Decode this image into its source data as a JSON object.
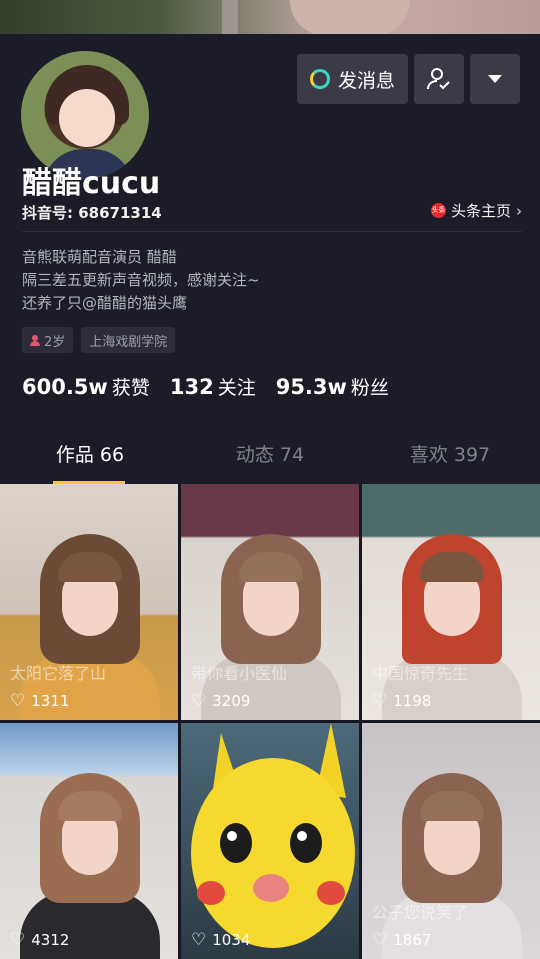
{
  "profile": {
    "name": "醋醋cucu",
    "douyin_id": "抖音号: 68671314",
    "toutiao_label": "头条主页",
    "toutiao_logo": "头条",
    "chevron": "›",
    "bio": [
      "音熊联萌配音演员 醋醋",
      "隔三差五更新声音视频，感谢关注~",
      "还养了只@醋醋的猫头鹰"
    ],
    "tags": [
      {
        "icon": "person-icon",
        "label": "2岁"
      },
      {
        "label": "上海戏剧学院"
      }
    ]
  },
  "actions": {
    "message_label": "发消息",
    "follow_icon": "user-check-icon",
    "more_icon": "dropdown-triangle-icon"
  },
  "stats": [
    {
      "value": "600.5w",
      "label": "获赞"
    },
    {
      "value": "132",
      "label": "关注"
    },
    {
      "value": "95.3w",
      "label": "粉丝"
    }
  ],
  "tabs": [
    {
      "label": "作品 66",
      "active": true
    },
    {
      "label": "动态 74",
      "active": false
    },
    {
      "label": "喜欢 397",
      "active": false
    }
  ],
  "videos": [
    {
      "likes": "1311",
      "caption": "太阳它落了山"
    },
    {
      "likes": "3209",
      "caption": "带你看小医仙"
    },
    {
      "likes": "1198",
      "caption": "中国惊奇先生"
    },
    {
      "likes": "4312",
      "caption": ""
    },
    {
      "likes": "1034",
      "caption": ""
    },
    {
      "likes": "1867",
      "caption": "公子您说笑了"
    }
  ],
  "colors": {
    "background": "#161722",
    "tab_underline": "#f5c543",
    "button_bg": "#3a3b46",
    "tag_bg": "#2c2d38"
  }
}
